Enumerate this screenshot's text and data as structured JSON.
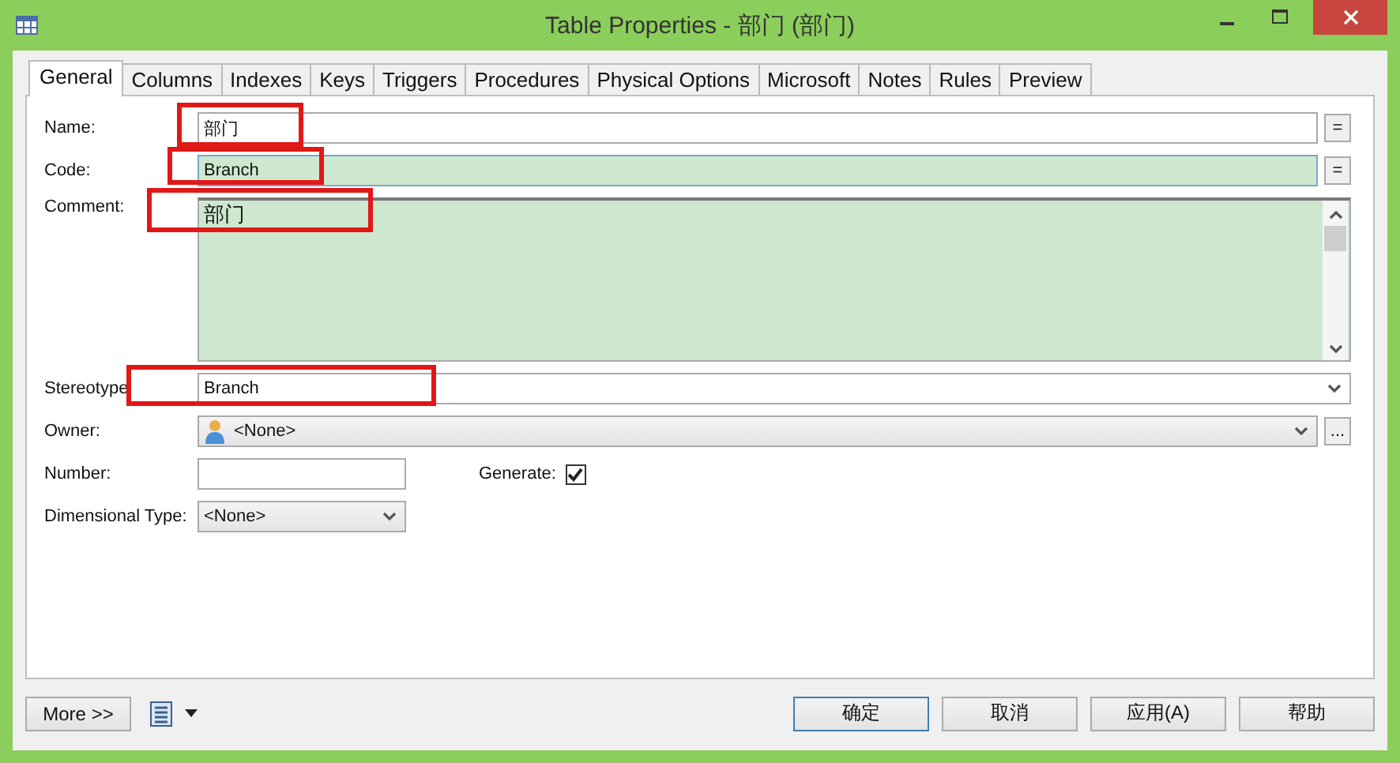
{
  "window": {
    "title": "Table Properties - 部门 (部门)"
  },
  "tabs": [
    {
      "label": "General",
      "selected": true
    },
    {
      "label": "Columns",
      "selected": false
    },
    {
      "label": "Indexes",
      "selected": false
    },
    {
      "label": "Keys",
      "selected": false
    },
    {
      "label": "Triggers",
      "selected": false
    },
    {
      "label": "Procedures",
      "selected": false
    },
    {
      "label": "Physical Options",
      "selected": false
    },
    {
      "label": "Microsoft",
      "selected": false
    },
    {
      "label": "Notes",
      "selected": false
    },
    {
      "label": "Rules",
      "selected": false
    },
    {
      "label": "Preview",
      "selected": false
    }
  ],
  "fields": [
    {
      "kind": "text",
      "label": "Name:",
      "value": "部门",
      "highlighted": true,
      "focused": false,
      "tinted": false,
      "button": "="
    },
    {
      "kind": "text",
      "label": "Code:",
      "value": "Branch",
      "highlighted": true,
      "focused": true,
      "tinted": true,
      "button": "="
    },
    {
      "kind": "memo",
      "label": "Comment:",
      "value": "部门",
      "highlighted": true,
      "focused": false,
      "tinted": true
    },
    {
      "kind": "combo",
      "label": "Stereotype",
      "value": "Branch",
      "highlighted": true,
      "focused": false,
      "tinted": false
    },
    {
      "kind": "owner",
      "label": "Owner:",
      "value": "<None>",
      "highlighted": false,
      "focused": false,
      "tinted": false,
      "button": "..."
    }
  ],
  "number": {
    "label": "Number:"
  },
  "generate": {
    "label": "Generate:",
    "checked": true
  },
  "dimensional_type": {
    "label": "Dimensional Type:",
    "value": "<None>"
  },
  "footer": {
    "more": "More >>",
    "buttons": [
      {
        "label": "确定",
        "default": true
      },
      {
        "label": "取消",
        "default": false
      },
      {
        "label": "应用(A)",
        "default": false
      },
      {
        "label": "帮助",
        "default": false
      }
    ]
  }
}
